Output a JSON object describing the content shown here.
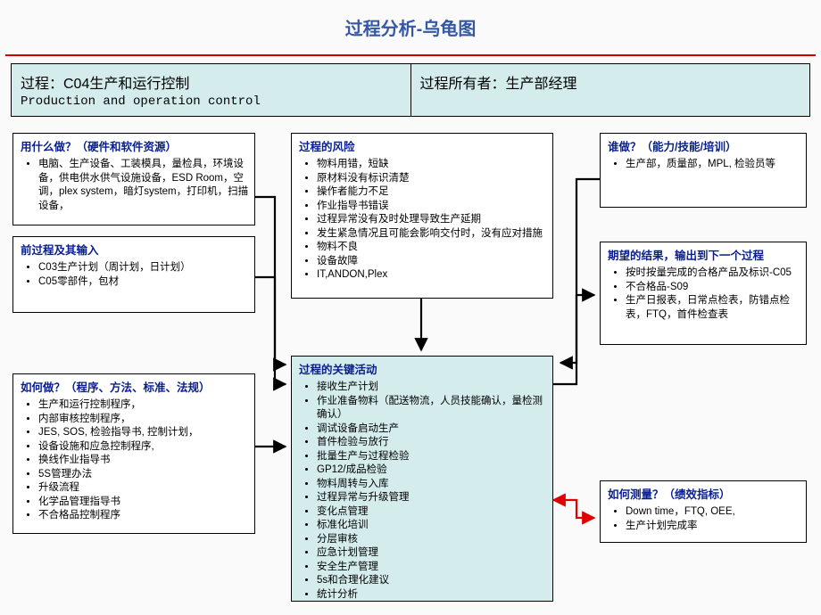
{
  "page_title": "过程分析-乌龟图",
  "header": {
    "process_label": "过程：C04生产和运行控制",
    "process_label_en": "Production and operation control",
    "owner_label": "过程所有者：生产部经理"
  },
  "boxes": {
    "resources": {
      "title": "用什么做？（硬件和软件资源）",
      "items": [
        "电脑、生产设备、工装模具，量检具，环境设备，供电供水供气设施设备，ESD Room，空调，plex system，暗灯system，打印机，扫描设备，"
      ]
    },
    "prev_inputs": {
      "title": "前过程及其输入",
      "items": [
        "C03生产计划（周计划，日计划）",
        "C05零部件，包材"
      ]
    },
    "howdo": {
      "title": "如何做？（程序、方法、标准、法规）",
      "items": [
        "生产和运行控制程序，",
        "内部审核控制程序，",
        "JES, SOS, 检验指导书, 控制计划，",
        "设备设施和应急控制程序,",
        "换线作业指导书",
        "5S管理办法",
        "升级流程",
        "化学品管理指导书",
        "不合格品控制程序"
      ]
    },
    "risks": {
      "title": "过程的风险",
      "items": [
        "物料用错，短缺",
        "原材料没有标识清楚",
        "操作者能力不足",
        "作业指导书错误",
        "过程异常没有及时处理导致生产延期",
        "发生紧急情况且可能会影响交付时，没有应对措施",
        "物料不良",
        "设备故障",
        "IT,ANDON,Plex"
      ]
    },
    "key_activities": {
      "title": "过程的关键活动",
      "items": [
        "接收生产计划",
        "作业准备物料（配送物流，人员技能确认，量检测确认）",
        "调试设备启动生产",
        "首件检验与放行",
        "批量生产与过程检验",
        "GP12/成品检验",
        "物料周转与入库",
        "过程异常与升级管理",
        "变化点管理",
        "标准化培训",
        "分层审核",
        "应急计划管理",
        "安全生产管理",
        "5s和合理化建议",
        "统计分析"
      ]
    },
    "who": {
      "title": "谁做？（能力/技能/培训）",
      "items": [
        "生产部，质量部，MPL, 检验员等"
      ]
    },
    "outputs": {
      "title": "期望的结果，输出到下一个过程",
      "items": [
        "按时按量完成的合格产品及标识-C05",
        "不合格品-S09",
        "生产日报表，日常点检表，防错点检表，FTQ，首件检查表"
      ]
    },
    "measure": {
      "title": "如何测量？（绩效指标）",
      "items": [
        "Down time，FTQ, OEE,",
        "生产计划完成率"
      ]
    }
  }
}
